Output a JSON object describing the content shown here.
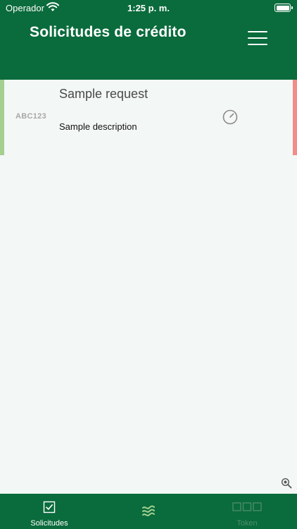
{
  "status_bar": {
    "carrier": "Operador",
    "time": "1:25 p. m."
  },
  "header": {
    "title": "Solicitudes de crédito",
    "menu_icon": "hamburger-menu-icon"
  },
  "requests": [
    {
      "code": "ABC123",
      "title": "Sample request",
      "description": "Sample description",
      "status_icon": "gauge-icon"
    }
  ],
  "tabs": [
    {
      "label": "Solicitudes",
      "icon": "checkbox-icon",
      "active": true
    },
    {
      "label": "",
      "icon": "waves-icon",
      "active": false
    },
    {
      "label": "Token",
      "icon": "token-boxes-icon",
      "active": false
    }
  ],
  "colors": {
    "primary": "#0a6b3c",
    "background": "#f3f7f5",
    "card_left_accent": "#a3cf8f",
    "card_right_accent": "#f08c8a",
    "inactive_tab": "#4e8f6b",
    "waves_icon": "#a3cf8f"
  }
}
